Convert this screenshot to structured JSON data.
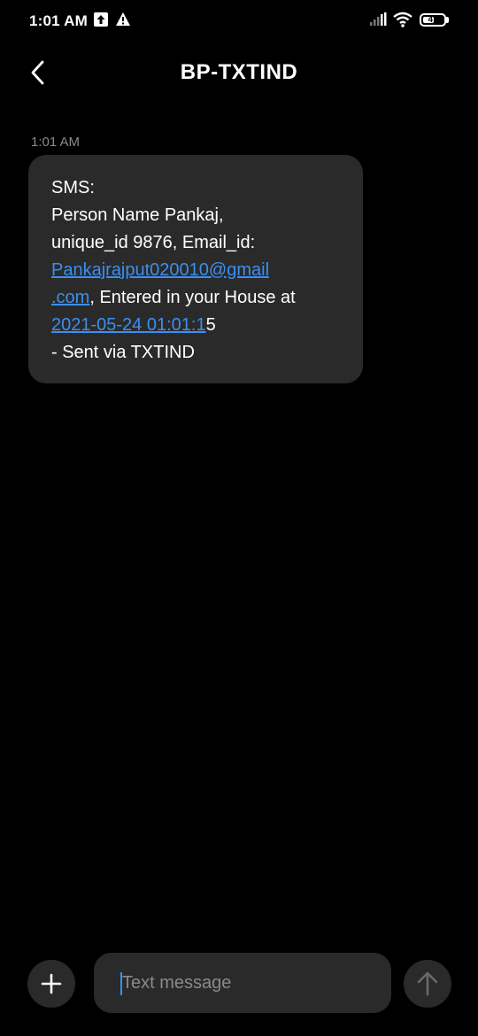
{
  "status_bar": {
    "time": "1:01 AM",
    "battery": "47",
    "icons": [
      "upload-icon",
      "alert-icon",
      "signal-icon",
      "wifi-icon",
      "battery-icon"
    ]
  },
  "header": {
    "title": "BP-TXTIND",
    "back_icon": "back-arrow-icon"
  },
  "conversation": {
    "timestamp": "1:01 AM",
    "message": {
      "line1": "SMS:",
      "line2": "Person Name Pankaj,",
      "line3": "unique_id  9876, Email_id:",
      "email_part1": "Pankajrajput020010@gmail",
      "email_part2": ".com",
      "line5_rest": ", Entered in your House at",
      "date_link": "2021-05-24 01:01:1",
      "date_tail": "5",
      "line7": "- Sent via TXTIND"
    }
  },
  "composer": {
    "placeholder": "Text message",
    "add_icon": "plus-icon",
    "send_icon": "send-arrow-icon"
  },
  "colors": {
    "background": "#000000",
    "bubble": "#2a2a2a",
    "link": "#3b8ff0",
    "muted": "#8a8a8a"
  }
}
